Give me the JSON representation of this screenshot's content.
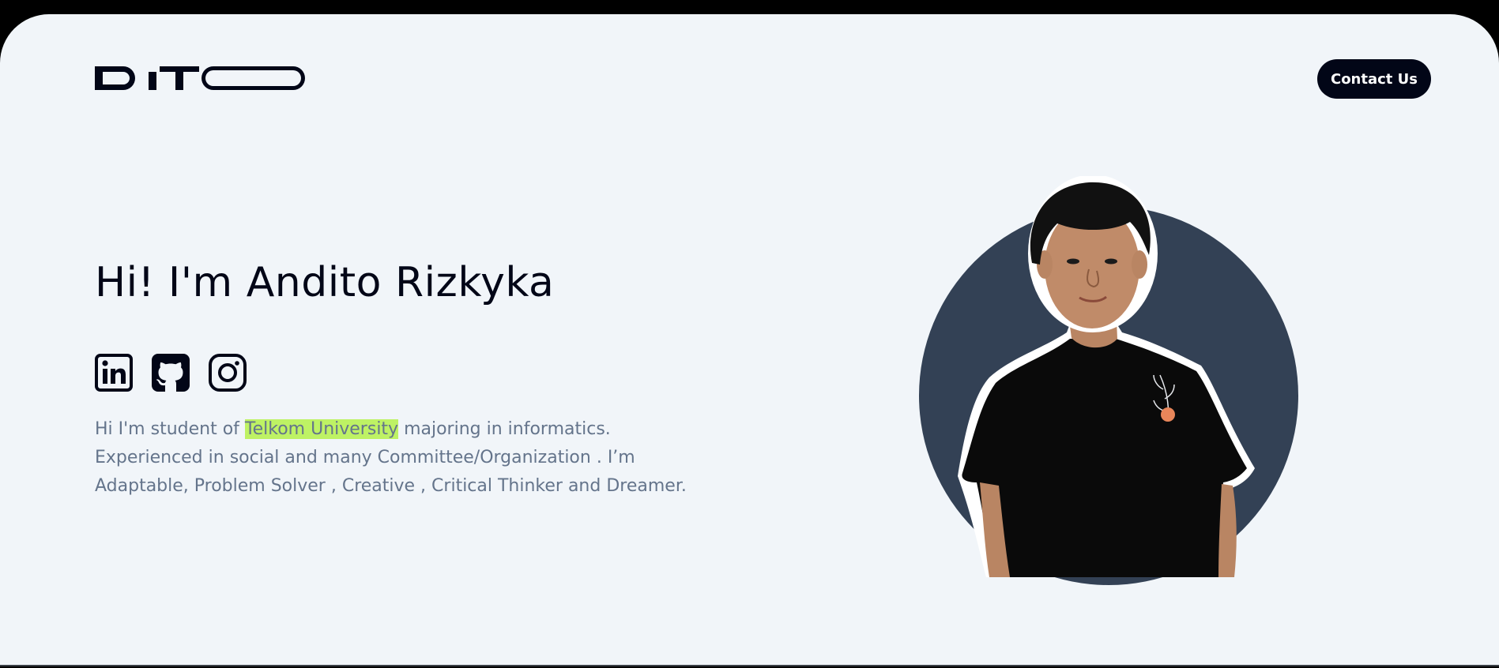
{
  "header": {
    "logo_alt": "DITO",
    "contact_label": "Contact Us"
  },
  "hero": {
    "title": "Hi! I'm Andito Rizkyka",
    "bio_prefix": "Hi I'm student of ",
    "bio_highlight": "Telkom University",
    "bio_line1_rest": " majoring in informatics.",
    "bio_line2": "Experienced in social and many Committee/Organization . I’m",
    "bio_line3": "Adaptable, Problem Solver , Creative , Critical Thinker and Dreamer."
  },
  "socials": [
    {
      "name": "linkedin",
      "icon": "linkedin-icon"
    },
    {
      "name": "github",
      "icon": "github-icon"
    },
    {
      "name": "instagram",
      "icon": "instagram-icon"
    }
  ],
  "colors": {
    "background": "#f1f5f9",
    "text_dark": "#020617",
    "text_muted": "#64748b",
    "highlight": "#bef264",
    "portrait_circle": "#334155"
  }
}
